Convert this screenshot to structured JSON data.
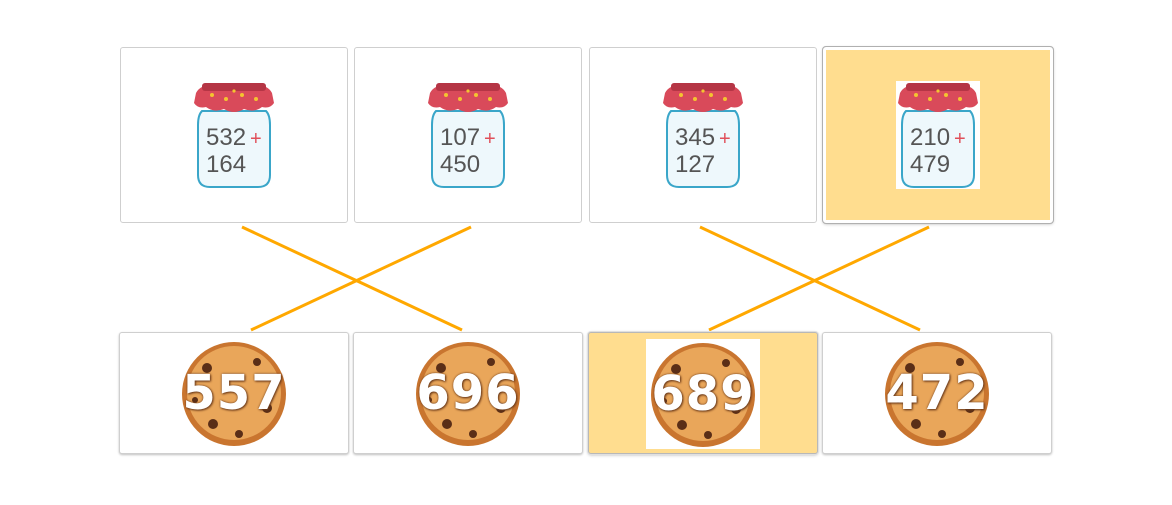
{
  "jars": [
    {
      "a": "532",
      "b": "164",
      "op": "+"
    },
    {
      "a": "107",
      "b": "450",
      "op": "+"
    },
    {
      "a": "345",
      "b": "127",
      "op": "+"
    },
    {
      "a": "210",
      "b": "479",
      "op": "+"
    }
  ],
  "cookies": [
    "557",
    "696",
    "689",
    "472"
  ],
  "selected": {
    "jar": 3,
    "cookie": 2
  },
  "colors": {
    "line": "#ffa800",
    "selected_bg": "#ffdd8f",
    "lid": "#d94a5a",
    "jar_outline": "#3aa6c9"
  }
}
